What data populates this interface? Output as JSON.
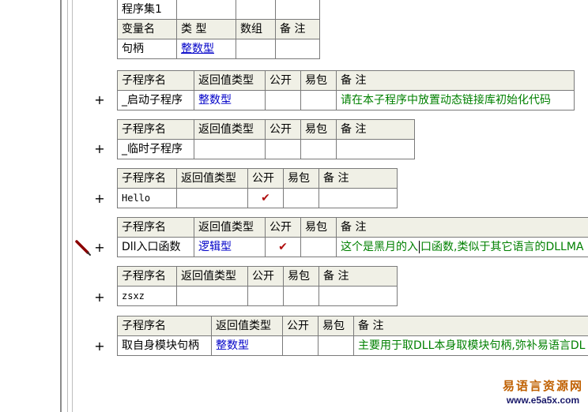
{
  "assembly": {
    "row1": "程序集1",
    "header": [
      "变量名",
      "类 型",
      "数组",
      "备 注"
    ],
    "var": {
      "name": "句柄",
      "type": "整数型",
      "array": "",
      "note": ""
    }
  },
  "subprograms": [
    {
      "header": [
        "子程序名",
        "返回值类型",
        "公开",
        "易包",
        "备 注"
      ],
      "name": "_启动子程序",
      "ret": "整数型",
      "public": "",
      "easy": "",
      "note": "请在本子程序中放置动态链接库初始化代码"
    },
    {
      "header": [
        "子程序名",
        "返回值类型",
        "公开",
        "易包",
        "备 注"
      ],
      "name": "_临时子程序",
      "ret": "",
      "public": "",
      "easy": "",
      "note": ""
    },
    {
      "header": [
        "子程序名",
        "返回值类型",
        "公开",
        "易包",
        "备 注"
      ],
      "name": "Hello",
      "ret": "",
      "public": "✔",
      "easy": "",
      "note": ""
    },
    {
      "header": [
        "子程序名",
        "返回值类型",
        "公开",
        "易包",
        "备 注"
      ],
      "name": "Dll入口函数",
      "ret": "逻辑型",
      "public": "✔",
      "easy": "",
      "note_a": "这个是黑月的入",
      "note_b": "口函数,类似于其它语言的DLLMA"
    },
    {
      "header": [
        "子程序名",
        "返回值类型",
        "公开",
        "易包",
        "备 注"
      ],
      "name": "zsxz",
      "ret": "",
      "public": "",
      "easy": "",
      "note": ""
    },
    {
      "header": [
        "子程序名",
        "返回值类型",
        "公开",
        "易包",
        "备 注"
      ],
      "name": "取自身模块句柄",
      "ret": "整数型",
      "public": "",
      "easy": "",
      "note": "主要用于取DLL本身取模块句柄,弥补易语言DL"
    }
  ],
  "expand_symbol": "+",
  "watermark": {
    "title": "易语言资源网",
    "url": "www.e5a5x.com"
  },
  "colors": {
    "type": "#0000c8",
    "note": "#008000",
    "check": "#b01010",
    "header_bg": "#f0f0e6"
  },
  "icons": {
    "gutter_marker": "red-pen-icon"
  }
}
